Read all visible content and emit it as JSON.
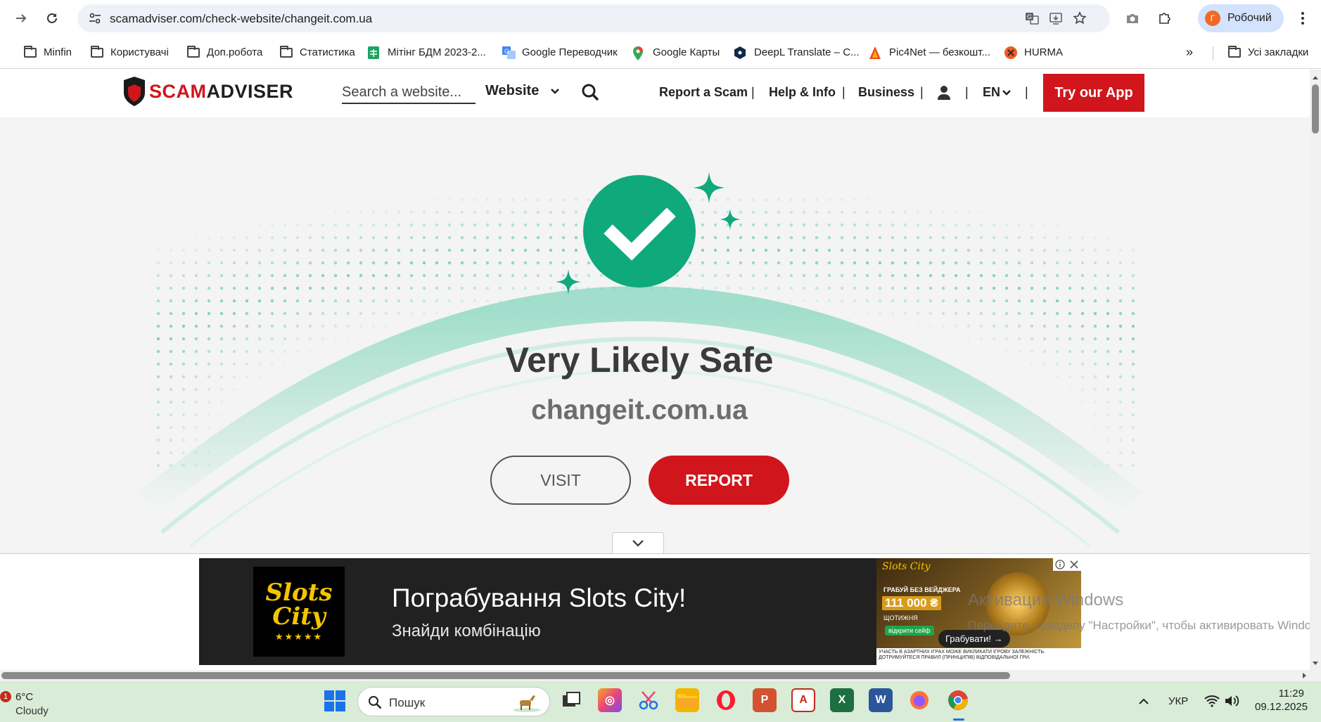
{
  "browser": {
    "url": "scamadviser.com/check-website/changeit.com.ua",
    "profile_initial": "Г",
    "profile_name": "Робочий",
    "bookmarks": [
      {
        "label": "Minfin",
        "icon": "folder-icon"
      },
      {
        "label": "Користувачі",
        "icon": "folder-icon"
      },
      {
        "label": "Доп.робота",
        "icon": "folder-icon"
      },
      {
        "label": "Статистика",
        "icon": "folder-icon"
      },
      {
        "label": "Мітінг БДМ 2023-2...",
        "icon": "sheets-icon"
      },
      {
        "label": "Google Переводчик",
        "icon": "translate-icon"
      },
      {
        "label": "Google Карты",
        "icon": "maps-icon"
      },
      {
        "label": "DeepL Translate – C...",
        "icon": "deepl-icon"
      },
      {
        "label": "Pic4Net — безкошт...",
        "icon": "pic4net-icon"
      },
      {
        "label": "HURMA",
        "icon": "hurma-icon"
      }
    ],
    "all_bookmarks": "Усі закладки"
  },
  "site": {
    "logo_text_red": "SCAM",
    "logo_text_dark": "ADVISER",
    "search_placeholder": "Search a website...",
    "search_type": "Website",
    "nav": {
      "report": "Report a Scam",
      "help": "Help & Info",
      "business": "Business",
      "lang": "EN",
      "sep": "|"
    },
    "app_button": "Try our App"
  },
  "result": {
    "verdict": "Very Likely Safe",
    "domain": "changeit.com.ua",
    "visit": "VISIT",
    "report": "REPORT",
    "accent": "#0fa97c"
  },
  "ad": {
    "logo_line1": "Slots",
    "logo_line2": "City",
    "logo_stars": "★★★★★",
    "title": "Пограбування Slots City!",
    "subtitle": "Знайди комбінацію",
    "banner_brand": "Slots City",
    "banner_line1": "ГРАБУЙ БЕЗ ВЕЙДЖЕРА",
    "banner_amount": "111 000 ₴",
    "banner_line2": "ЩОТИЖНЯ",
    "banner_cta": "відкрити сейф",
    "banner_button": "Грабувати! →",
    "banner_disclaimer": "УЧАСТЬ В АЗАРТНИХ ІГРАХ МОЖЕ ВИКЛИКАТИ ІГРОВУ ЗАЛЕЖНІСТЬ. ДОТРИМУЙТЕСЯ ПРАВИЛ (ПРИНЦИПІВ) ВІДПОВІДАЛЬНОЇ ГРИ."
  },
  "windows_watermark": {
    "title": "Активация Windows",
    "subtitle": "Перейдите к разделу \"Настройки\", чтобы активировать Windows."
  },
  "taskbar": {
    "weather_badge": "1",
    "temperature": "6°C",
    "condition": "Cloudy",
    "search": "Пошук",
    "language": "УКР",
    "time": "11:29",
    "date": "09.12.2025"
  }
}
